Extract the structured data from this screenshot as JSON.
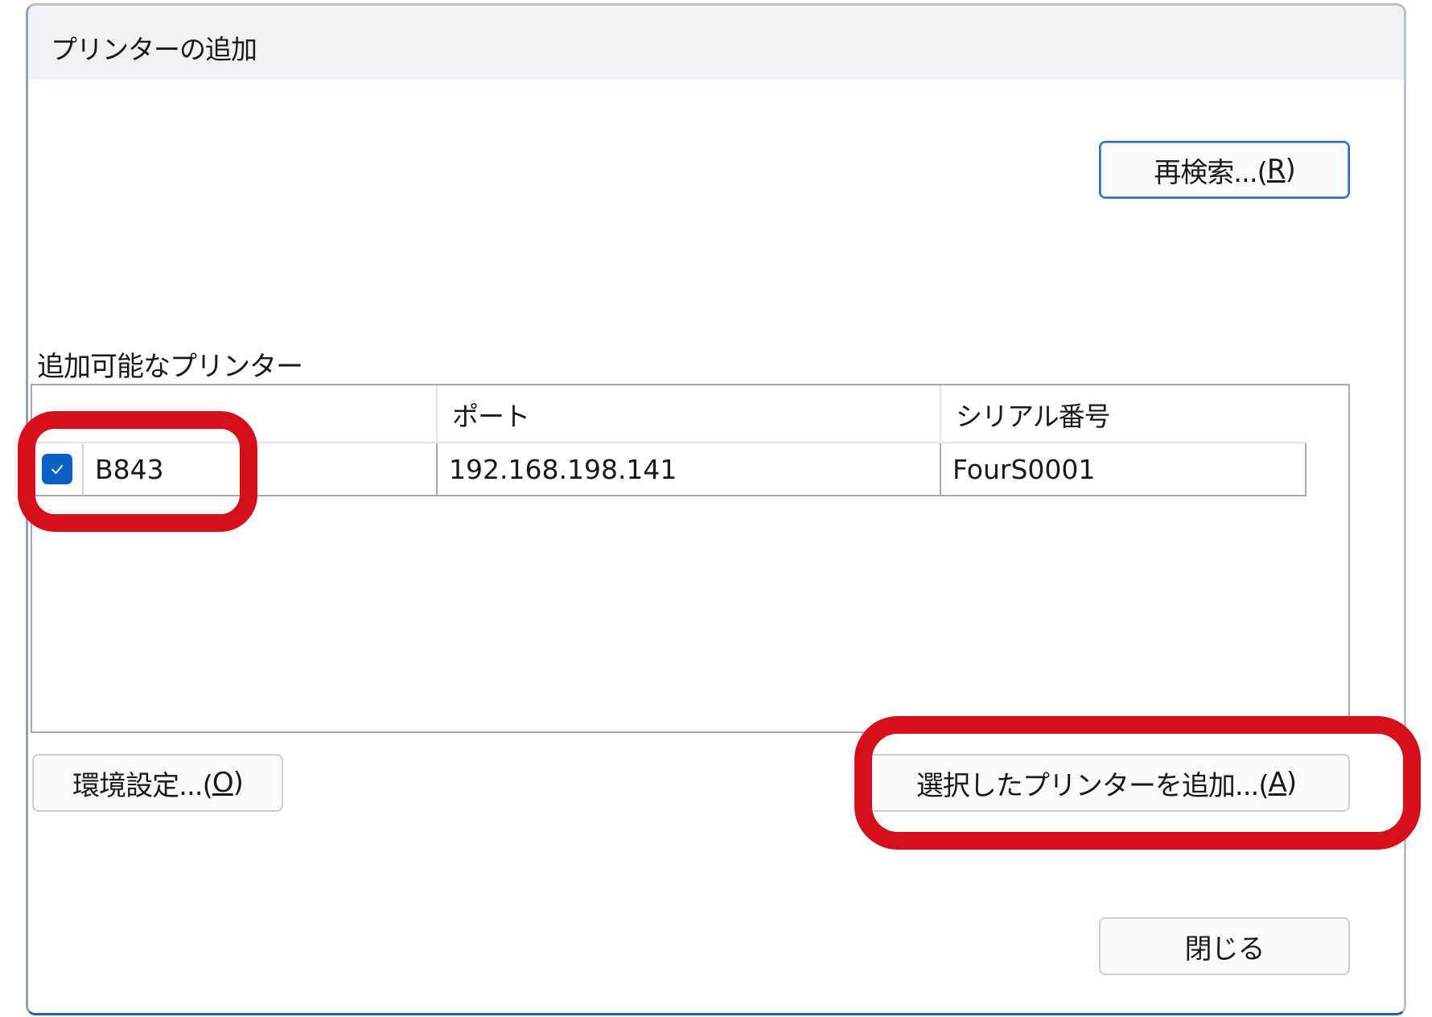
{
  "window": {
    "title": "プリンターの追加"
  },
  "buttons": {
    "rescan_label": "再検索...(",
    "rescan_key": "R",
    "settings_label": "環境設定...(",
    "settings_key": "O",
    "add_label": "選択したプリンターを追加...(",
    "add_key": "A",
    "close_label": "閉じる",
    "close_paren": ")"
  },
  "printer_list": {
    "label": "追加可能なプリンター",
    "columns": [
      "",
      "ポート",
      "シリアル番号"
    ],
    "rows": [
      {
        "checked": true,
        "name": "B843",
        "port": "192.168.198.141",
        "serial": "FourS0001"
      }
    ]
  },
  "colors": {
    "accent": "#0a63c4",
    "highlight": "#d3101c"
  }
}
